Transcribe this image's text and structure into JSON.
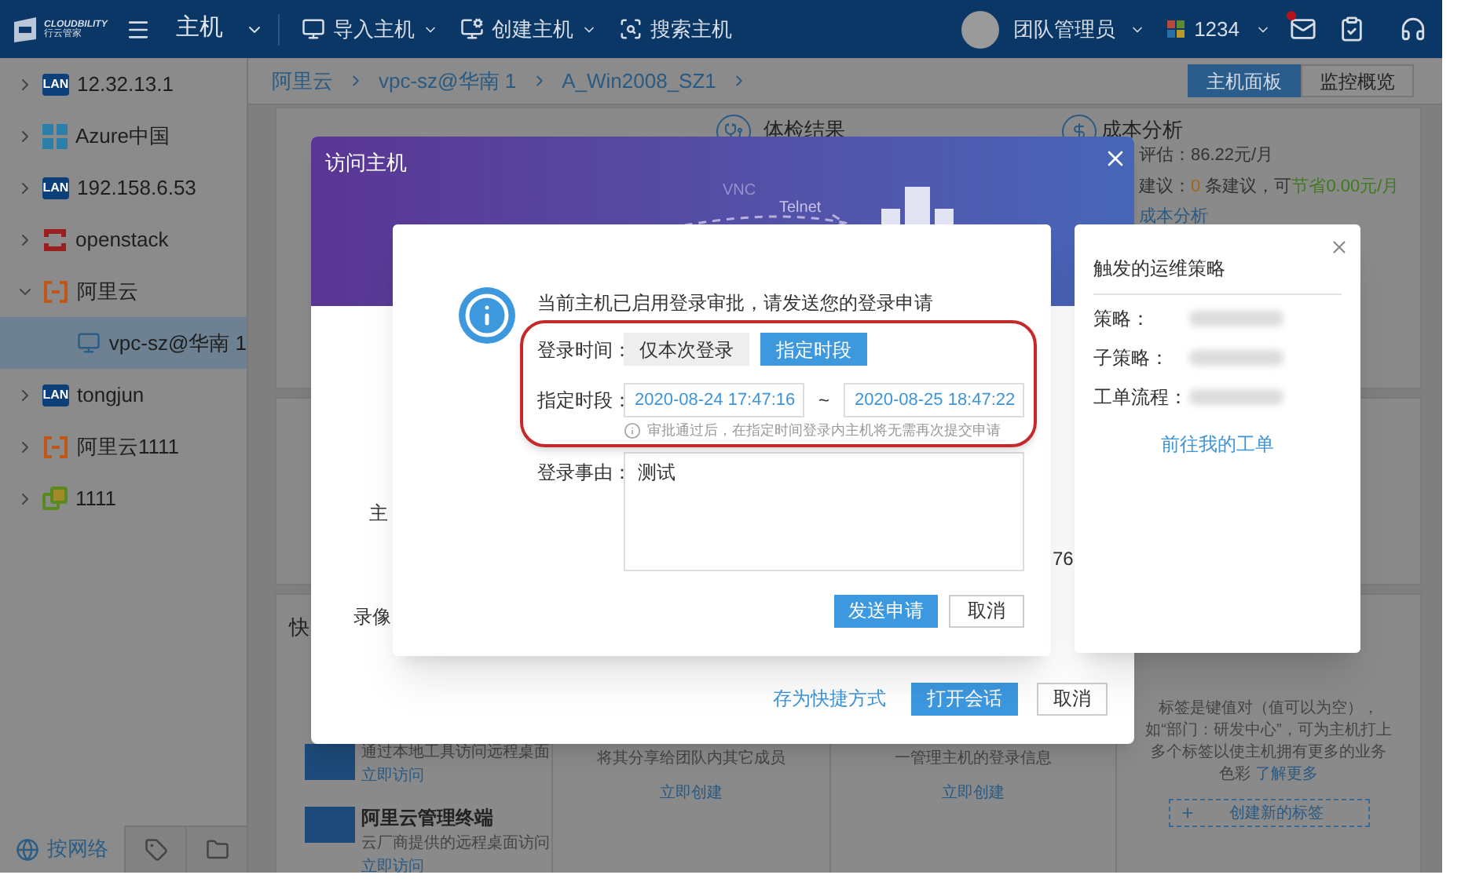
{
  "top_bar": {
    "logo": {
      "name": "CLOUDBILITY",
      "subtitle": "行云管家"
    },
    "module": "主机",
    "menus": [
      {
        "label": "导入主机",
        "kind": "import",
        "dropdown": true
      },
      {
        "label": "创建主机",
        "kind": "create",
        "dropdown": true
      },
      {
        "label": "搜索主机",
        "kind": "search",
        "dropdown": false
      }
    ],
    "user": "团队管理员",
    "org": "1234",
    "unread_mail": true
  },
  "sidebar": {
    "items": [
      {
        "label": "12.32.13.1",
        "kind": "lan",
        "badge": "LAN",
        "expanded": false,
        "selected": false
      },
      {
        "label": "Azure中国",
        "kind": "windows",
        "expanded": false,
        "selected": false
      },
      {
        "label": "192.158.6.53",
        "kind": "lan",
        "badge": "LAN",
        "expanded": false,
        "selected": false
      },
      {
        "label": "openstack",
        "kind": "openstack",
        "expanded": false,
        "selected": false
      },
      {
        "label": "阿里云",
        "kind": "aliyun",
        "expanded": true,
        "selected": false,
        "children": [
          {
            "label": "vpc-sz@华南 1",
            "kind": "vpc",
            "selected": true
          }
        ]
      },
      {
        "label": "tongjun",
        "kind": "lan",
        "badge": "LAN",
        "expanded": false,
        "selected": false
      },
      {
        "label": "阿里云1111",
        "kind": "aliyun",
        "expanded": false,
        "selected": false
      },
      {
        "label": "1111",
        "kind": "vmware",
        "expanded": false,
        "selected": false
      }
    ],
    "footer_tabs": [
      {
        "label": "按网络",
        "kind": "network",
        "selected": true
      },
      {
        "kind": "tag",
        "selected": false
      },
      {
        "kind": "folder",
        "selected": false
      }
    ]
  },
  "breadcrumb": [
    "阿里云",
    "vpc-sz@华南 1",
    "A_Win2008_SZ1"
  ],
  "view_tabs": [
    {
      "label": "主机面板",
      "selected": true
    },
    {
      "label": "监控概览",
      "selected": false
    }
  ],
  "health_card": {
    "title": "体检结果"
  },
  "cost_card": {
    "title": "成本分析",
    "estimate": "评估：86.22元/月",
    "suggestion": {
      "prefix": "建议：",
      "count": "0",
      "middle": " 条建议，可",
      "saving": "节省0.00元/月"
    },
    "link": "成本分析"
  },
  "quick_access": {
    "title": "快",
    "items": [
      {
        "description": "通过本地工具访问远程桌面",
        "link": "立即访问"
      },
      {
        "title": "阿里云管理终端",
        "description": "云厂商提供的远程桌面访问",
        "link": "立即访问"
      }
    ],
    "columns": [
      {
        "description": "将其分享给团队内其它成员",
        "link": "立即创建"
      },
      {
        "description": "一管理主机的登录信息",
        "link": "立即创建"
      }
    ]
  },
  "tags_card": {
    "description": "标签是键值对（值可以为空），如“部门：研发中心”，可为主机打上多个标签以使主机拥有更多的业务色彩",
    "link": "了解更多",
    "create_button": "创建新的标签"
  },
  "access_dialog": {
    "title": "访问主机",
    "decoration_labels": [
      "VNC",
      "Telnet"
    ],
    "field_labels": [
      "主",
      "录像"
    ],
    "field_value": "76",
    "shortcut_link": "存为快捷方式",
    "open_button": "打开会话",
    "cancel_button": "取消"
  },
  "approval_dialog": {
    "message": "当前主机已启用登录审批，请发送您的登录申请",
    "highlighted": true,
    "login_time": {
      "label": "登录时间：",
      "options": [
        {
          "label": "仅本次登录",
          "selected": false
        },
        {
          "label": "指定时段",
          "selected": true
        }
      ]
    },
    "period": {
      "label": "指定时段：",
      "start": "2020-08-24 17:47:16",
      "separator": "~",
      "end": "2020-08-25 18:47:22",
      "hint": "审批通过后，在指定时间登录内主机将无需再次提交申请"
    },
    "reason": {
      "label": "登录事由：",
      "value": "测试"
    },
    "submit_button": "发送申请",
    "cancel_button": "取消"
  },
  "policy_popover": {
    "title": "触发的运维策略",
    "fields": [
      {
        "label": "策略："
      },
      {
        "label": "子策略："
      },
      {
        "label": "工单流程："
      }
    ],
    "link": "前往我的工单"
  }
}
